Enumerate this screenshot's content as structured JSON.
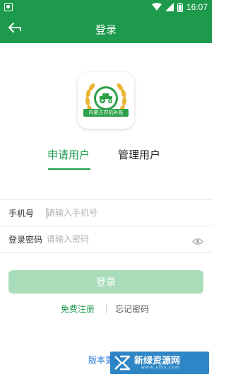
{
  "status_bar": {
    "time": "16:07"
  },
  "header": {
    "title": "登录"
  },
  "logo": {
    "caption": "内蒙古农机补贴"
  },
  "tabs": [
    {
      "label": "申请用户",
      "active": true
    },
    {
      "label": "管理用户",
      "active": false
    }
  ],
  "form": {
    "phone": {
      "label": "手机号",
      "placeholder": "请输入手机号",
      "value": ""
    },
    "password": {
      "label": "登录密码",
      "placeholder": "请输入密码",
      "value": ""
    }
  },
  "actions": {
    "login_label": "登录",
    "register_label": "免费注册",
    "forgot_label": "忘记密码",
    "update_label": "版本更新"
  },
  "watermark": {
    "name": "新绿资源网",
    "site": "www.xlhs.com"
  },
  "colors": {
    "primary": "#1e9a4c",
    "button_disabled": "#a9dcb9",
    "link_blue": "#2a7ad8"
  },
  "icons": [
    "app-notification-icon",
    "wifi-icon",
    "signal-icon",
    "battery-icon",
    "back-arrow-icon",
    "tractor-icon",
    "wheat-wreath-icon",
    "eye-icon"
  ]
}
